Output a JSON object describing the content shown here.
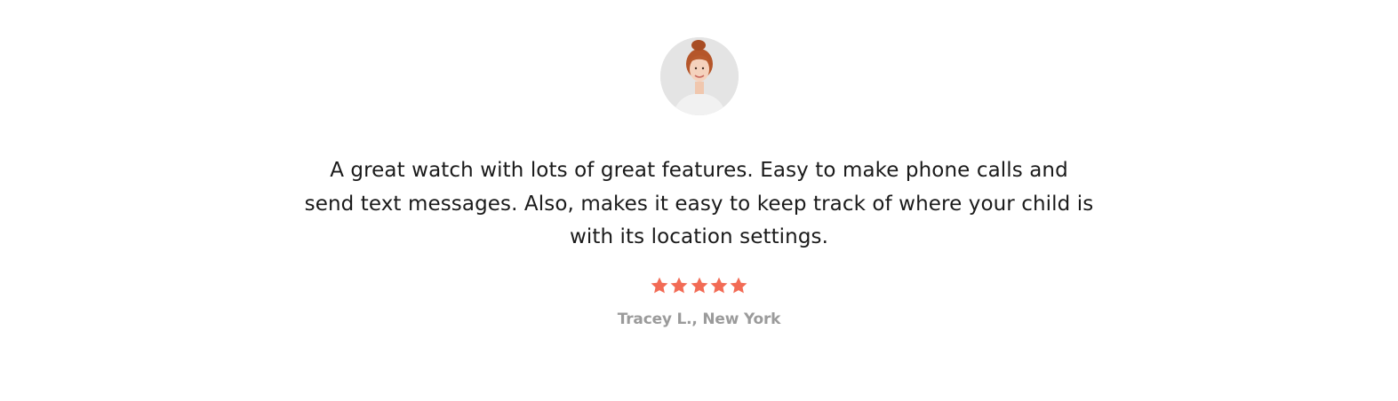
{
  "testimonial": {
    "quote": "A great watch with lots of great features. Easy to make phone calls and send text messages. Also, makes it easy to keep track of where your child is with its location settings.",
    "author": "Tracey L., New York",
    "rating": {
      "value": 5,
      "max": 5
    },
    "avatar_icon": "avatar-photo"
  },
  "colors": {
    "star": "#f26b55",
    "quote_text": "#1a1a1a",
    "author_text": "#9b9b9b"
  }
}
